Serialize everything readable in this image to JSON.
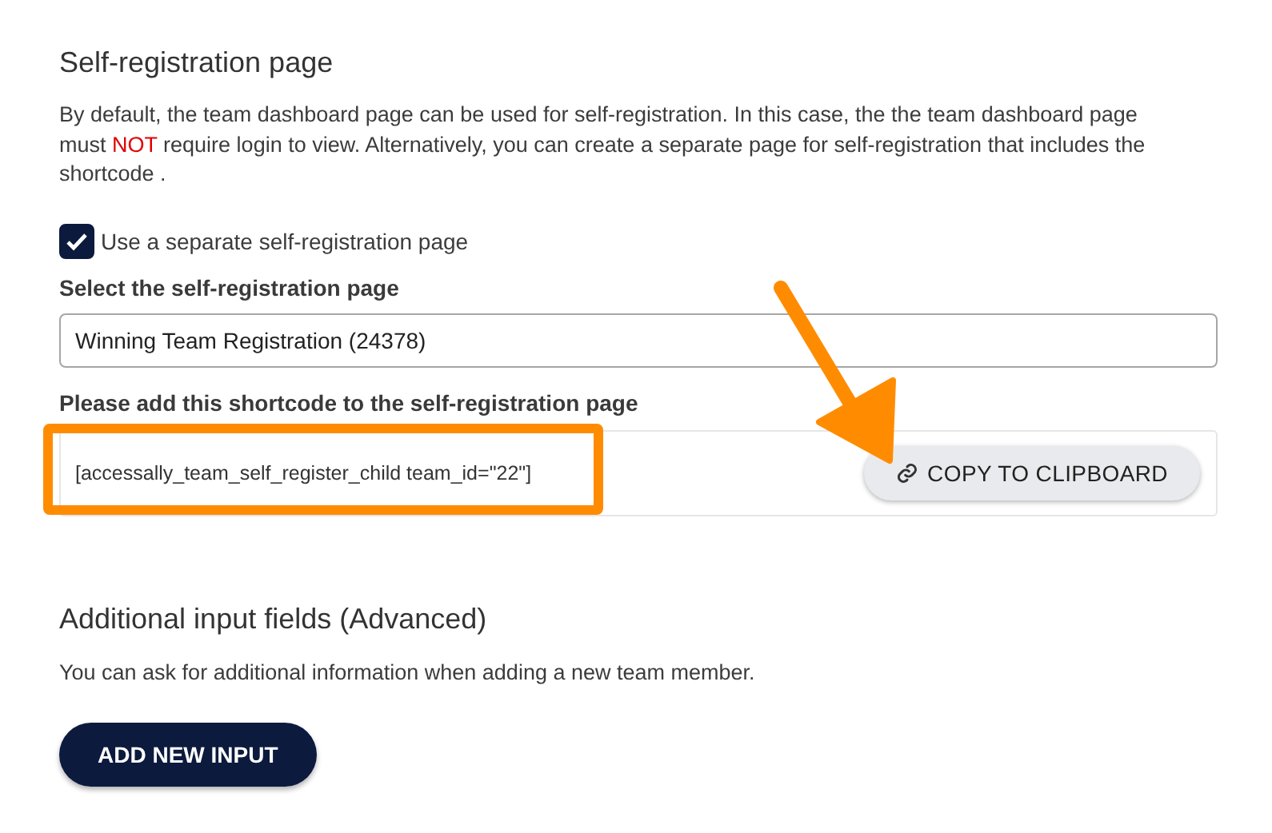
{
  "registration": {
    "title": "Self-registration page",
    "description": {
      "before": "By default, the team dashboard page can be used for self-registration. In this case, the the team dashboard page must ",
      "emphasis": "NOT",
      "after": " require login to view. Alternatively, you can create a separate page for self-registration that includes the shortcode ."
    },
    "separate_page": {
      "label": "Use a separate self-registration page",
      "checked": true
    },
    "select_label": "Select the self-registration page",
    "select_value": "Winning Team Registration (24378)",
    "shortcode_label": "Please add this shortcode to the self-registration page",
    "shortcode": "[accessally_team_self_register_child team_id=\"22\"]",
    "copy_button": "COPY TO CLIPBOARD"
  },
  "additional": {
    "title": "Additional input fields (Advanced)",
    "description": "You can ask for additional information when adding a new team member.",
    "add_button": "ADD NEW INPUT"
  }
}
